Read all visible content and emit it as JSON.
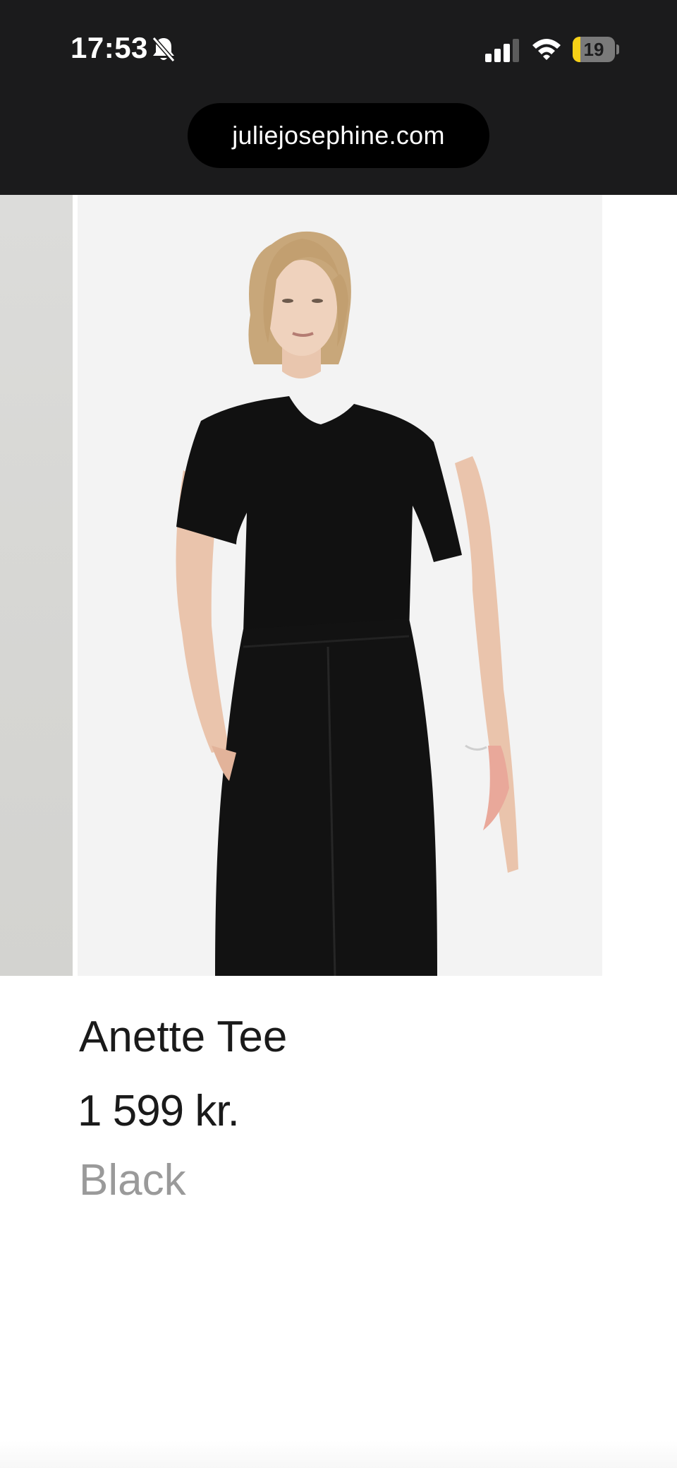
{
  "status_bar": {
    "time": "17:53",
    "battery_level": "19",
    "battery_percent": 19,
    "colors": {
      "background": "#1b1b1c",
      "battery_low": "#f7d117"
    },
    "icons": [
      "bell-slash-icon",
      "cellular-signal-icon",
      "wifi-icon",
      "battery-icon"
    ]
  },
  "browser": {
    "url": "juliejosephine.com"
  },
  "product": {
    "name": "Anette Tee",
    "price": "1 599 kr.",
    "color": "Black"
  }
}
